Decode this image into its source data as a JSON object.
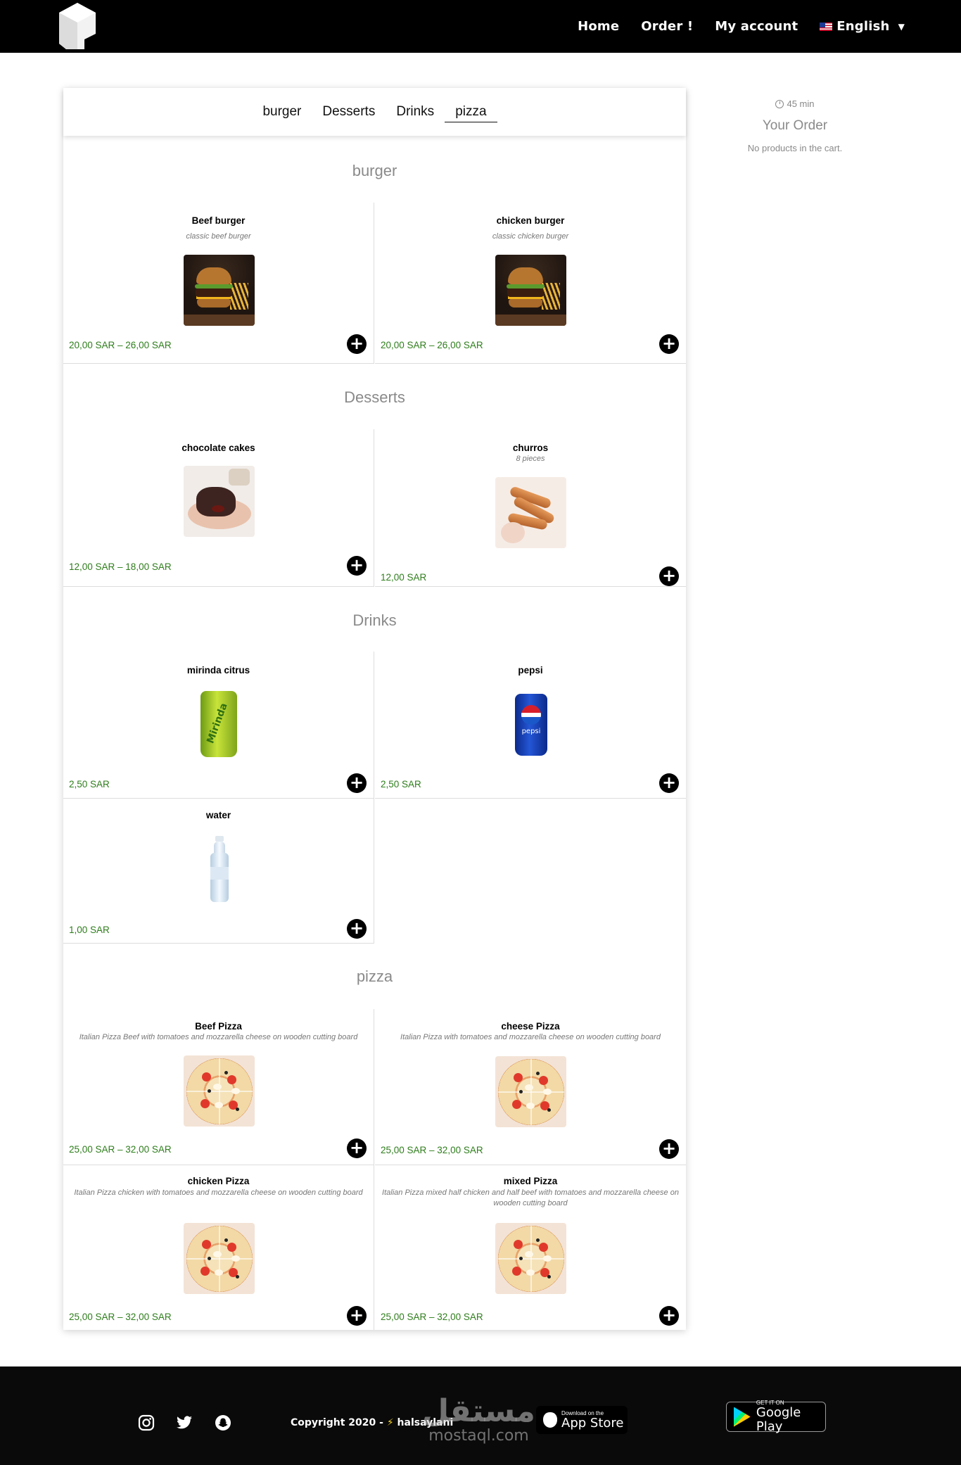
{
  "header": {
    "nav": {
      "home": "Home",
      "order": "Order !",
      "account": "My account",
      "language": "English"
    }
  },
  "tabs": [
    "burger",
    "Desserts",
    "Drinks",
    "pizza"
  ],
  "sections": {
    "burger": {
      "title": "burger",
      "items": [
        {
          "name": "Beef burger",
          "desc": "classic beef burger",
          "price": "20,00 SAR – 26,00 SAR"
        },
        {
          "name": "chicken burger",
          "desc": "classic chicken burger",
          "price": "20,00 SAR – 26,00 SAR"
        }
      ]
    },
    "desserts": {
      "title": "Desserts",
      "items": [
        {
          "name": "chocolate cakes",
          "desc": "",
          "price": "12,00 SAR – 18,00 SAR"
        },
        {
          "name": "churros",
          "desc": "8 pieces",
          "price": "12,00 SAR"
        }
      ]
    },
    "drinks": {
      "title": "Drinks",
      "items": [
        {
          "name": "mirinda citrus",
          "desc": "",
          "price": "2,50 SAR"
        },
        {
          "name": "pepsi",
          "desc": "",
          "price": "2,50 SAR"
        },
        {
          "name": "water",
          "desc": "",
          "price": "1,00 SAR"
        }
      ]
    },
    "pizza": {
      "title": "pizza",
      "items": [
        {
          "name": "Beef Pizza",
          "desc": "Italian Pizza Beef with tomatoes and mozzarella cheese on wooden cutting board",
          "price": "25,00 SAR – 32,00 SAR"
        },
        {
          "name": "cheese Pizza",
          "desc": "Italian Pizza with tomatoes and mozzarella cheese on wooden cutting board",
          "price": "25,00 SAR – 32,00 SAR"
        },
        {
          "name": "chicken Pizza",
          "desc": "Italian Pizza chicken with tomatoes and mozzarella cheese on wooden cutting board",
          "price": "25,00 SAR – 32,00 SAR"
        },
        {
          "name": "mixed Pizza",
          "desc": "Italian Pizza mixed  half chicken and half beef with tomatoes and mozzarella cheese on wooden cutting board",
          "price": "25,00 SAR – 32,00 SAR"
        }
      ]
    }
  },
  "order_panel": {
    "eta": "45 min",
    "title": "Your Order",
    "empty_text": "No products in the cart."
  },
  "footer": {
    "copyright": "Copyright 2020 -",
    "brand": "halsaylani",
    "watermark_ar": "مستقل",
    "watermark_url": "mostaql.com",
    "app_store_small": "Download on the",
    "app_store_big": "App Store",
    "google_small": "GET IT ON",
    "google_big": "Google Play"
  },
  "colors": {
    "price": "#2e7d1b",
    "header_bg": "#000000",
    "footer_bg": "#0a0a0a",
    "section_title": "#8a8a8a"
  },
  "icons": [
    "instagram-icon",
    "twitter-icon",
    "snapchat-icon",
    "plus-icon",
    "clock-icon",
    "chevron-down-icon",
    "us-flag-icon",
    "apple-icon",
    "google-play-icon"
  ]
}
